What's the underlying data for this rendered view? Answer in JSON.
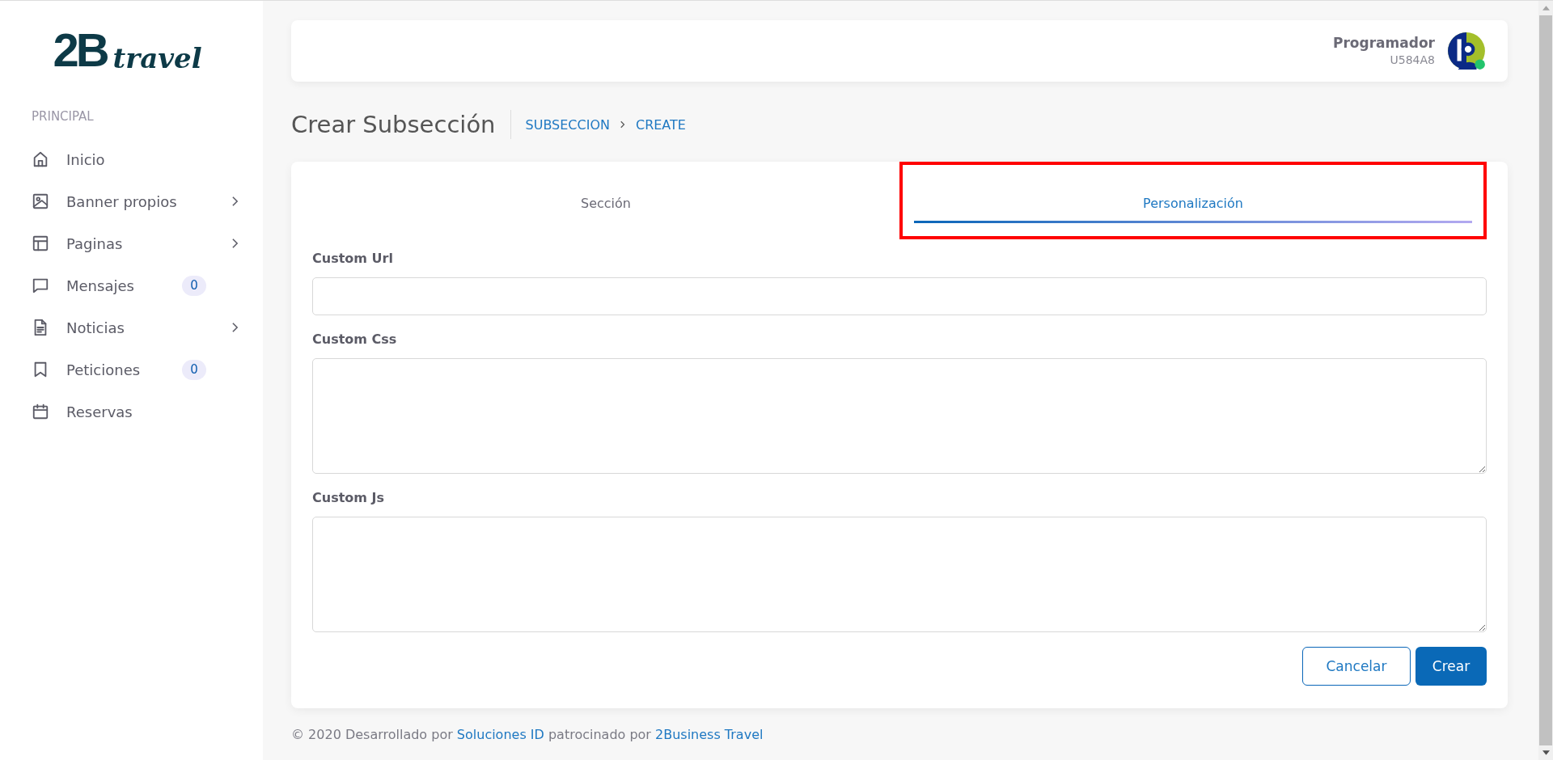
{
  "logo": {
    "primary": "2B",
    "secondary": "travel"
  },
  "sidebar": {
    "section": "PRINCIPAL",
    "items": [
      {
        "label": "Inicio",
        "kind": "home",
        "has_submenu": false
      },
      {
        "label": "Banner propios",
        "kind": "image",
        "has_submenu": true
      },
      {
        "label": "Paginas",
        "kind": "layout",
        "has_submenu": true
      },
      {
        "label": "Mensajes",
        "kind": "chat",
        "has_submenu": false,
        "badge": "0"
      },
      {
        "label": "Noticias",
        "kind": "document",
        "has_submenu": true
      },
      {
        "label": "Peticiones",
        "kind": "bookmark",
        "has_submenu": false,
        "badge": "0"
      },
      {
        "label": "Reservas",
        "kind": "calendar",
        "has_submenu": false
      }
    ]
  },
  "user": {
    "name": "Programador",
    "code": "U584A8",
    "online": true
  },
  "page": {
    "title": "Crear Subsección",
    "breadcrumb": [
      "SUBSECCION",
      "CREATE"
    ]
  },
  "tabs": [
    {
      "label": "Sección",
      "selected": false,
      "highlighted": false
    },
    {
      "label": "Personalización",
      "selected": true,
      "highlighted": true
    }
  ],
  "fields": [
    {
      "label": "Custom Url",
      "kind": "input"
    },
    {
      "label": "Custom Css",
      "kind": "textarea"
    },
    {
      "label": "Custom Js",
      "kind": "textarea"
    }
  ],
  "buttons": [
    {
      "label": "Cancelar",
      "kind": "secondary"
    },
    {
      "label": "Crear",
      "kind": "primary"
    }
  ],
  "footer": {
    "prefix": "© 2020 Desarrollado por",
    "link1": "Soluciones ID",
    "middle": "patrocinado por",
    "link2": "2Business Travel"
  }
}
